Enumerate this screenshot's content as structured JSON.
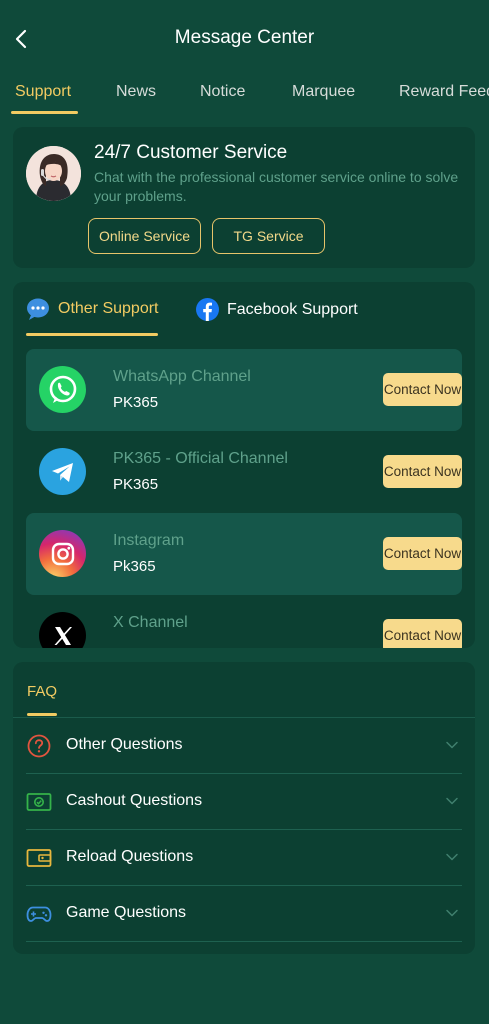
{
  "header": {
    "title": "Message Center"
  },
  "tabs": [
    {
      "label": "Support",
      "active": true
    },
    {
      "label": "News"
    },
    {
      "label": "Notice"
    },
    {
      "label": "Marquee"
    },
    {
      "label": "Reward Feed"
    }
  ],
  "customer_service": {
    "title": "24/7 Customer Service",
    "description": "Chat with the professional customer service online to solve your problems.",
    "buttons": [
      "Online Service",
      "TG Service"
    ]
  },
  "support_tabs": [
    {
      "label": "Other Support",
      "icon": "chat-bubble-icon",
      "active": true
    },
    {
      "label": "Facebook Support",
      "icon": "facebook-icon"
    }
  ],
  "channels": [
    {
      "name": "WhatsApp Channel",
      "sub": "PK365",
      "icon": "whatsapp-icon",
      "action": "Contact Now"
    },
    {
      "name": "PK365 - Official Channel",
      "sub": "PK365",
      "icon": "telegram-icon",
      "action": "Contact Now"
    },
    {
      "name": "Instagram",
      "sub": "Pk365",
      "icon": "instagram-icon",
      "action": "Contact Now"
    },
    {
      "name": "X Channel",
      "sub": "",
      "icon": "x-icon",
      "action": "Contact Now"
    }
  ],
  "faq": {
    "title": "FAQ",
    "items": [
      {
        "label": "Other Questions",
        "icon": "question-icon"
      },
      {
        "label": "Cashout Questions",
        "icon": "cashout-icon"
      },
      {
        "label": "Reload Questions",
        "icon": "wallet-icon"
      },
      {
        "label": "Game Questions",
        "icon": "gamepad-icon"
      }
    ]
  },
  "colors": {
    "background": "#0f4a3a",
    "card": "#0c4032",
    "accent": "#f2cb62",
    "muted_text": "#5fa18b",
    "contact_button": "#f7da8c"
  }
}
